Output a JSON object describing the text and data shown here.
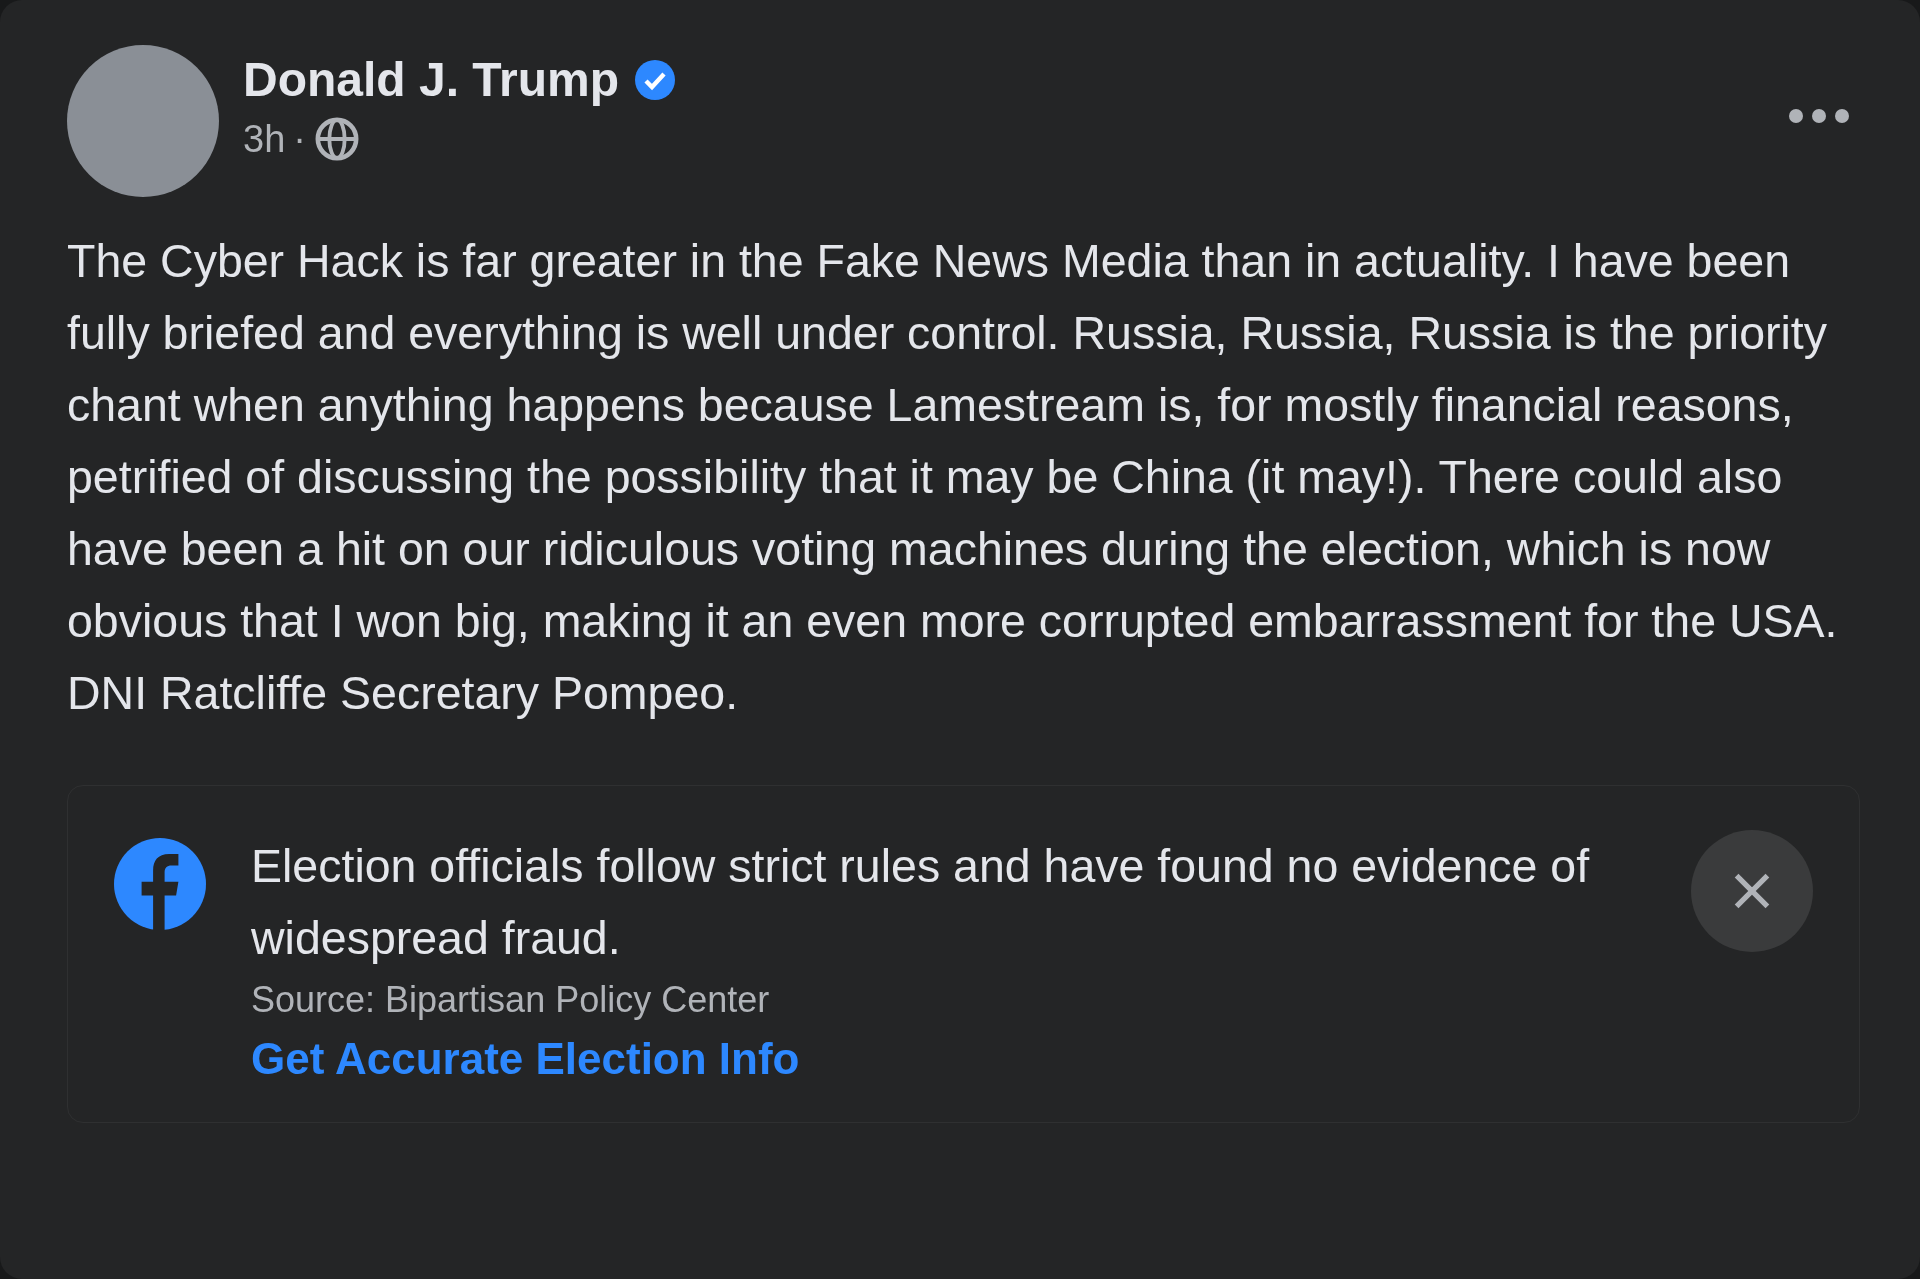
{
  "post": {
    "author": "Donald J. Trump",
    "verified": true,
    "time": "3h",
    "separator": "·",
    "text": "The Cyber Hack is far greater in the Fake News Media than in actuality. I have been fully briefed and everything is well under control. Russia, Russia, Russia is the priority chant when anything happens because Lamestream is, for mostly financial reasons, petrified of discussing the possibility that it may be China (it may!). There could also have been a hit on our ridiculous voting machines during the election, which is now obvious that I won big, making it an even more corrupted embarrassment for the USA. DNI Ratcliffe Secretary Pompeo."
  },
  "notice": {
    "text": "Election officials follow strict rules and have found no evidence of widespread fraud.",
    "source": "Source: Bipartisan Policy Center",
    "link": "Get Accurate Election Info"
  }
}
